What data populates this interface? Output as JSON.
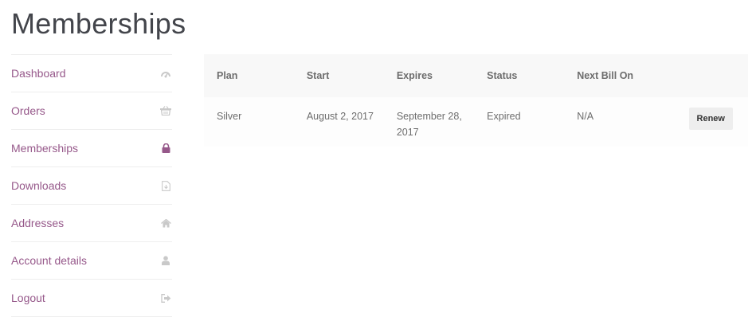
{
  "page_title": "Memberships",
  "nav": {
    "items": [
      {
        "label": "Dashboard",
        "icon": "dashboard-icon",
        "active": false
      },
      {
        "label": "Orders",
        "icon": "basket-icon",
        "active": false
      },
      {
        "label": "Memberships",
        "icon": "lock-icon",
        "active": true
      },
      {
        "label": "Downloads",
        "icon": "file-download-icon",
        "active": false
      },
      {
        "label": "Addresses",
        "icon": "home-icon",
        "active": false
      },
      {
        "label": "Account details",
        "icon": "user-icon",
        "active": false
      },
      {
        "label": "Logout",
        "icon": "sign-out-icon",
        "active": false
      }
    ]
  },
  "table": {
    "headers": [
      "Plan",
      "Start",
      "Expires",
      "Status",
      "Next Bill On",
      ""
    ],
    "rows": [
      {
        "plan": "Silver",
        "start": "August 2, 2017",
        "expires": "September 28, 2017",
        "status": "Expired",
        "next_bill_on": "N/A",
        "action_label": "Renew"
      }
    ]
  },
  "colors": {
    "link": "#96588a",
    "text": "#6d6d6d",
    "title": "#43454b",
    "icon_muted": "#c9c9c9",
    "icon_active": "#96588a",
    "header_bg": "#f8f8f8",
    "row_bg": "#fdfdfd",
    "button_bg": "#eeeeee"
  }
}
